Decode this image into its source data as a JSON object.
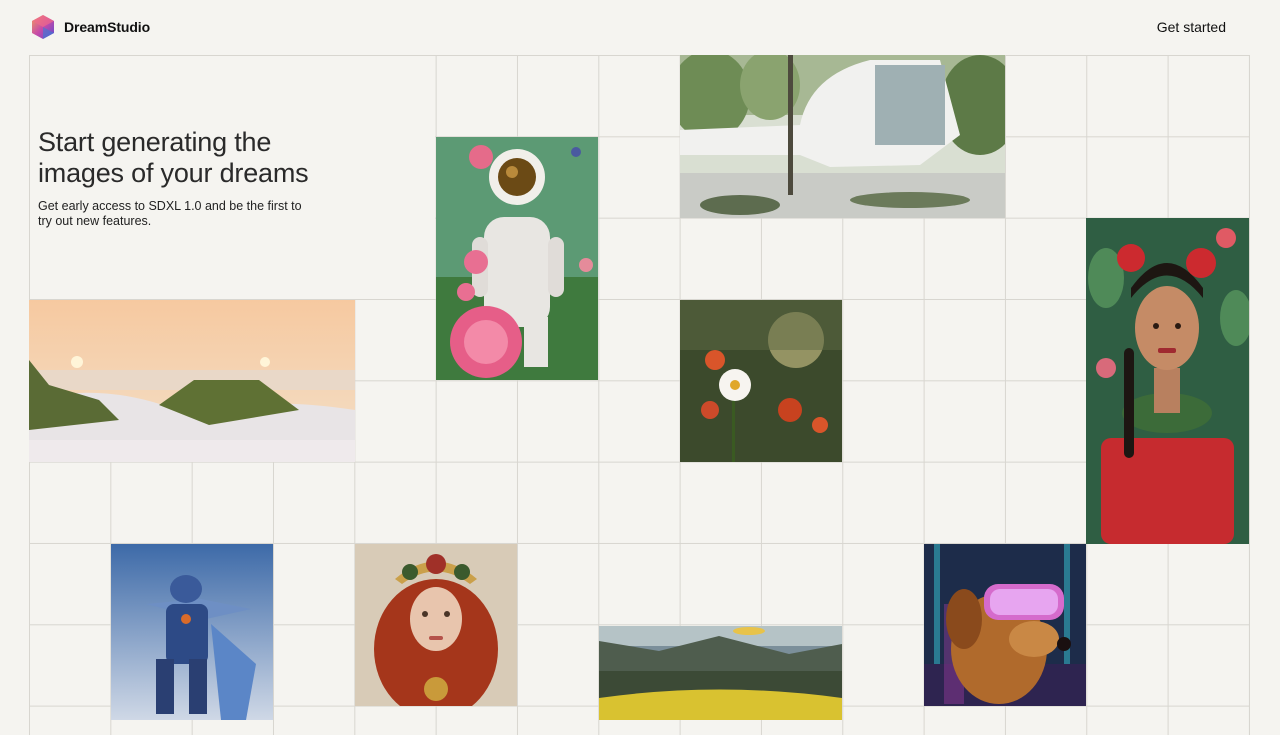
{
  "header": {
    "brand": "DreamStudio",
    "cta_label": "Get started"
  },
  "hero": {
    "title": "Start generating the images of your dreams",
    "subtitle": "Get early access to SDXL 1.0 and be the first to try out new features."
  },
  "gallery": {
    "images": [
      {
        "name": "astronaut-with-roses"
      },
      {
        "name": "modern-house-in-forest"
      },
      {
        "name": "woman-with-red-flowers-portrait"
      },
      {
        "name": "beach-dunes-sunset"
      },
      {
        "name": "daisy-flower-field"
      },
      {
        "name": "blue-robot-warrior"
      },
      {
        "name": "red-haired-woman-crown"
      },
      {
        "name": "yellow-valley-landscape"
      },
      {
        "name": "dog-with-vr-headset"
      }
    ]
  },
  "colors": {
    "background": "#f5f4f0",
    "grid_line": "#d8d6d0",
    "text": "#1d1d1f"
  }
}
